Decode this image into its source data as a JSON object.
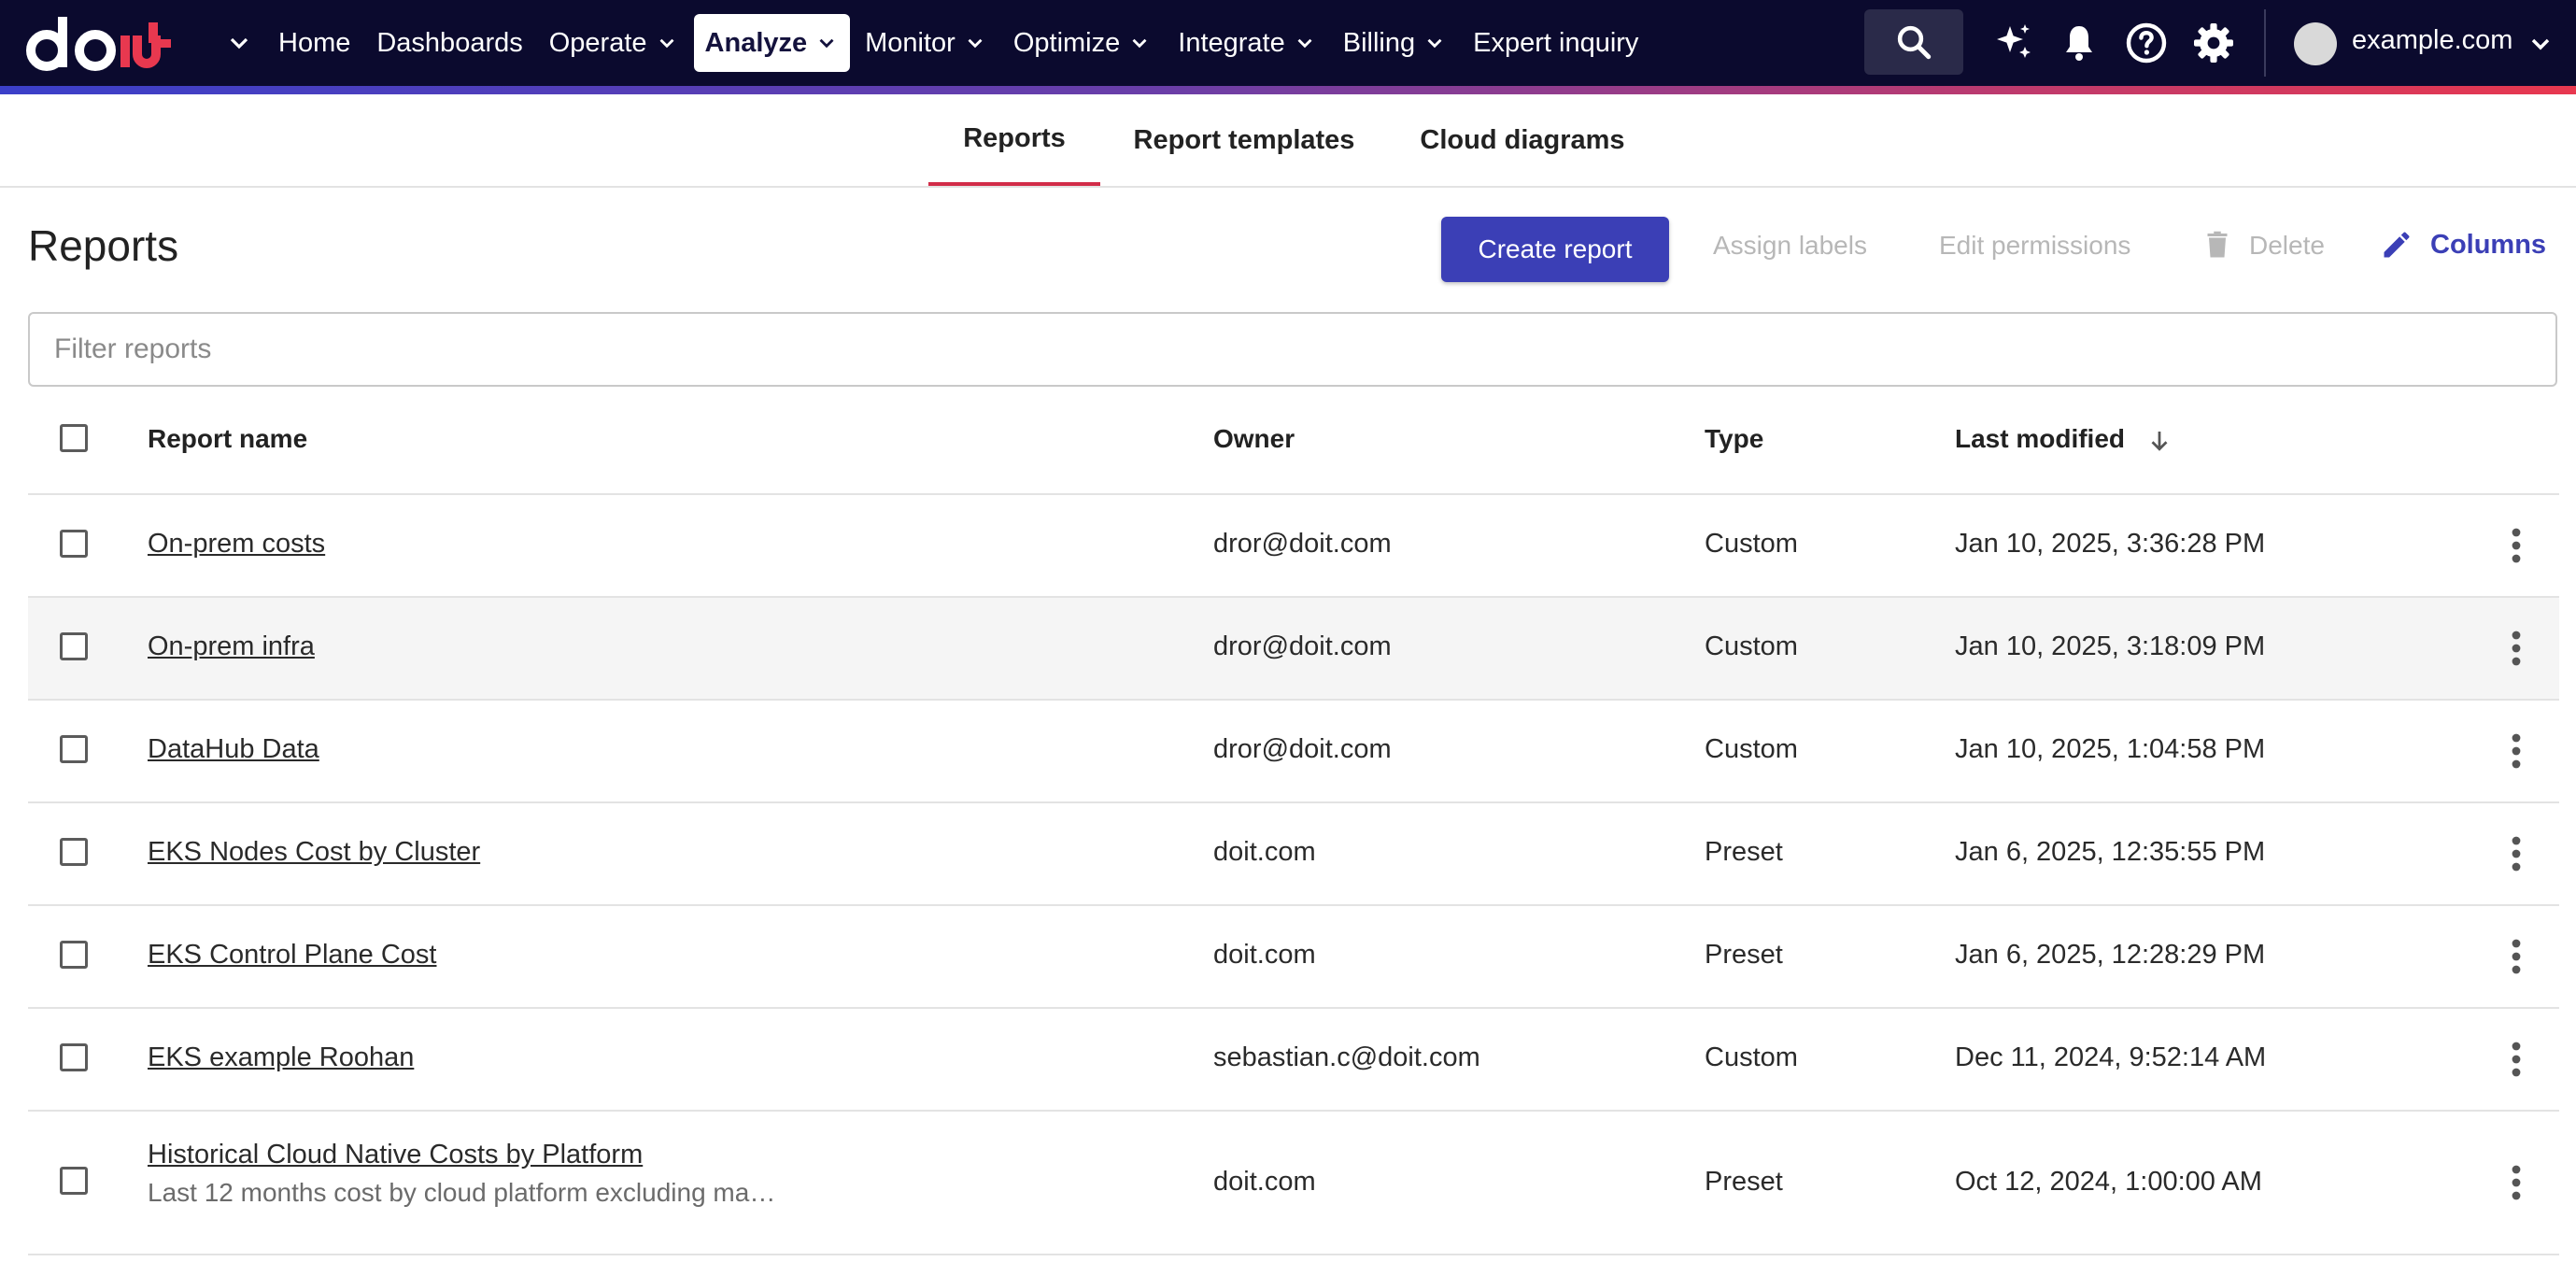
{
  "nav": {
    "items": [
      {
        "label": "Home",
        "dropdown": false,
        "active": false
      },
      {
        "label": "Dashboards",
        "dropdown": false,
        "active": false
      },
      {
        "label": "Operate",
        "dropdown": true,
        "active": false
      },
      {
        "label": "Analyze",
        "dropdown": true,
        "active": true
      },
      {
        "label": "Monitor",
        "dropdown": true,
        "active": false
      },
      {
        "label": "Optimize",
        "dropdown": true,
        "active": false
      },
      {
        "label": "Integrate",
        "dropdown": true,
        "active": false
      },
      {
        "label": "Billing",
        "dropdown": true,
        "active": false
      },
      {
        "label": "Expert inquiry",
        "dropdown": false,
        "active": false
      }
    ],
    "account": "example.com",
    "icons": [
      "search-icon",
      "sparkle-icon",
      "bell-icon",
      "help-icon",
      "gear-icon"
    ]
  },
  "tabs": [
    {
      "label": "Reports",
      "active": true
    },
    {
      "label": "Report templates",
      "active": false
    },
    {
      "label": "Cloud diagrams",
      "active": false
    }
  ],
  "page": {
    "title": "Reports",
    "create_label": "Create report",
    "assign_labels": "Assign labels",
    "edit_permissions": "Edit permissions",
    "delete_label": "Delete",
    "columns_label": "Columns",
    "filter_placeholder": "Filter reports"
  },
  "table": {
    "headers": {
      "name": "Report name",
      "owner": "Owner",
      "type": "Type",
      "modified": "Last modified"
    },
    "rows": [
      {
        "name": "On-prem costs",
        "owner": "dror@doit.com",
        "type": "Custom",
        "modified": "Jan 10, 2025, 3:36:28 PM"
      },
      {
        "name": "On-prem infra",
        "owner": "dror@doit.com",
        "type": "Custom",
        "modified": "Jan 10, 2025, 3:18:09 PM"
      },
      {
        "name": "DataHub Data",
        "owner": "dror@doit.com",
        "type": "Custom",
        "modified": "Jan 10, 2025, 1:04:58 PM"
      },
      {
        "name": "EKS Nodes Cost by Cluster",
        "owner": "doit.com",
        "type": "Preset",
        "modified": "Jan 6, 2025, 12:35:55 PM"
      },
      {
        "name": "EKS Control Plane Cost",
        "owner": "doit.com",
        "type": "Preset",
        "modified": "Jan 6, 2025, 12:28:29 PM"
      },
      {
        "name": "EKS example Roohan",
        "owner": "sebastian.c@doit.com",
        "type": "Custom",
        "modified": "Dec 11, 2024, 9:52:14 AM"
      },
      {
        "name": "Historical Cloud Native Costs by Platform",
        "description": "Last 12 months cost by cloud platform excluding ma…",
        "owner": "doit.com",
        "type": "Preset",
        "modified": "Oct 12, 2024, 1:00:00 AM"
      }
    ]
  },
  "colors": {
    "nav_bg": "#0b0a2e",
    "primary": "#3b3fb6",
    "tab_indicator": "#d22c48",
    "logo_accent": "#e8384f"
  }
}
